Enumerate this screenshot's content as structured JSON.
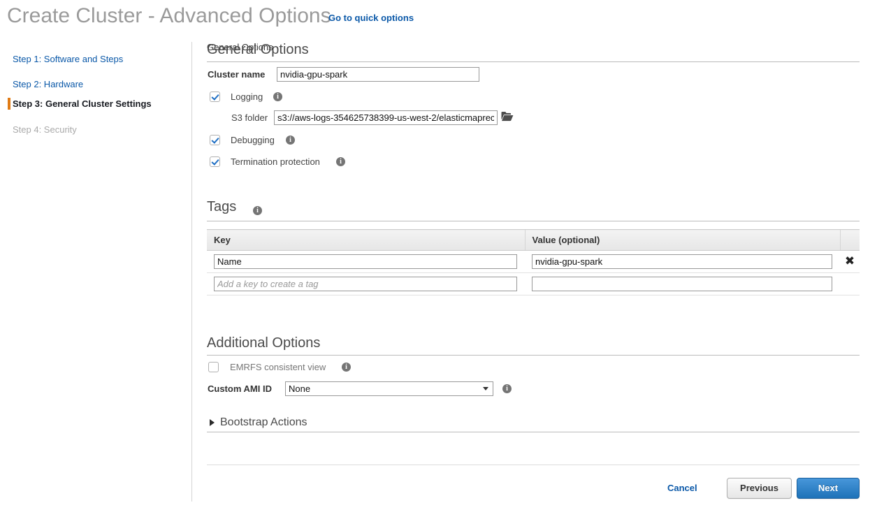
{
  "header": {
    "title": "Create Cluster - Advanced Options",
    "quick_options_link": "Go to quick options",
    "link_color": "#0a58a8",
    "title_color": "#9a9a9a"
  },
  "sidebar": {
    "current_marker_color": "#e07b15",
    "steps": [
      {
        "label": "Step 1: Software and Steps",
        "state": "link"
      },
      {
        "label": "Step 2: Hardware",
        "state": "link"
      },
      {
        "label": "Step 3: General Cluster Settings",
        "state": "current"
      },
      {
        "label": "Step 4: Security",
        "state": "disabled"
      }
    ]
  },
  "general_options": {
    "section_title": "General Options",
    "cluster_name": {
      "label": "Cluster name",
      "value": "nvidia-gpu-spark",
      "placeholder": ""
    },
    "logging": {
      "label": "Logging",
      "checked": true,
      "info_icon": "info-icon",
      "s3_folder": {
        "label": "S3 folder",
        "value": "s3://aws-logs-354625738399-us-west-2/elasticmaprec",
        "browse_icon": "folder-icon"
      }
    },
    "debugging": {
      "label": "Debugging",
      "checked": true,
      "info_icon": "info-icon"
    },
    "termination_protection": {
      "label": "Termination protection",
      "checked": true,
      "info_icon": "info-icon"
    }
  },
  "tags": {
    "section_title": "Tags",
    "info_icon": "info-icon",
    "columns": [
      "Key",
      "Value (optional)",
      ""
    ],
    "rows": [
      {
        "key": "Name",
        "value": "nvidia-gpu-spark",
        "key_placeholder": "",
        "value_placeholder": "",
        "delete_icon": "close-icon",
        "has_delete": true
      },
      {
        "key": "",
        "value": "",
        "key_placeholder": "Add a key to create a tag",
        "value_placeholder": "",
        "delete_icon": "",
        "has_delete": false
      }
    ]
  },
  "additional_options": {
    "section_title": "Additional Options",
    "emrfs_consistent_view": {
      "label": "EMRFS consistent view",
      "checked": false,
      "info_icon": "info-icon"
    },
    "custom_ami_id": {
      "label": "Custom AMI ID",
      "selected": "None",
      "options": [
        "None"
      ],
      "info_icon": "info-icon"
    },
    "bootstrap_actions": {
      "label": "Bootstrap Actions",
      "expanded": false,
      "arrow_icon": "chevron-right-icon"
    }
  },
  "footer": {
    "cancel_label": "Cancel",
    "previous_label": "Previous",
    "next_label": "Next",
    "primary_color": "#1e72b8"
  }
}
